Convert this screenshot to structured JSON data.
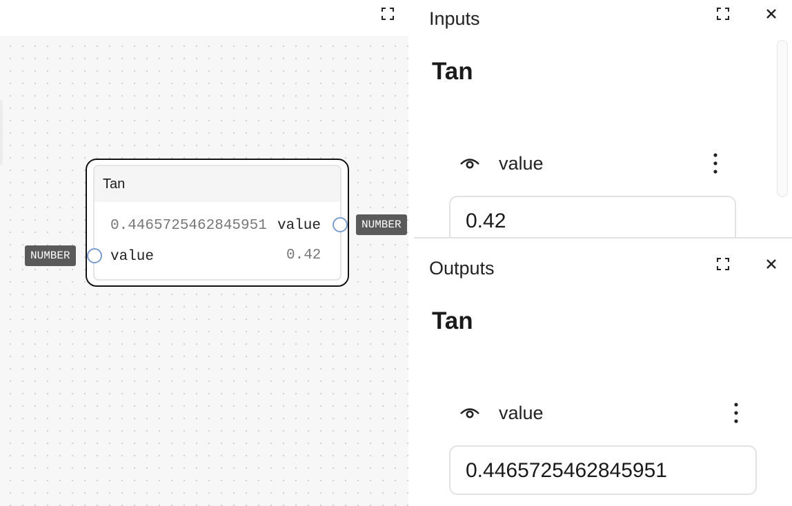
{
  "canvas": {
    "node": {
      "title": "Tan",
      "output_value": "0.4465725462845951",
      "output_label": "value",
      "input_label": "value",
      "input_value": "0.42"
    },
    "input_port_type": "NUMBER",
    "output_port_type": "NUMBER"
  },
  "inputs_panel": {
    "title": "Inputs",
    "node_name": "Tan",
    "field_label": "value",
    "field_value": "0.42"
  },
  "outputs_panel": {
    "title": "Outputs",
    "node_name": "Tan",
    "field_label": "value",
    "field_value": "0.4465725462845951"
  },
  "icons": {
    "fullscreen": "fullscreen-icon",
    "close": "close-icon",
    "visibility": "eye-icon",
    "more": "kebab-menu-icon"
  },
  "colors": {
    "port_border": "#7b9cd1",
    "type_badge": "#5a5a5a",
    "canvas_bg": "#f7f7f7"
  }
}
